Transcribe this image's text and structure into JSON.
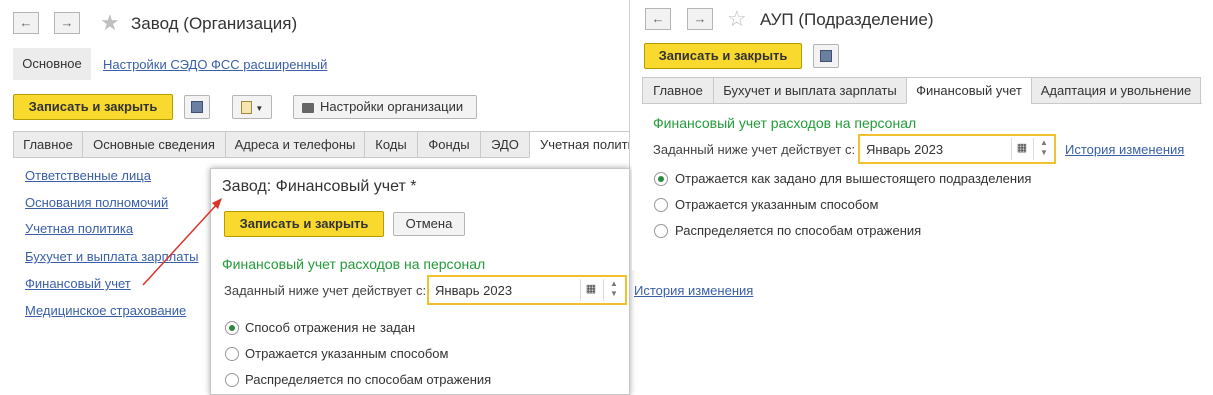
{
  "left_window": {
    "title": "Завод (Организация)",
    "nav_back": "🡐",
    "nav_forward": "🡒",
    "section_main": "Основное",
    "section_link": "Настройки СЭДО ФСС расширенный",
    "save_close": "Записать и закрыть",
    "org_settings": "Настройки организации",
    "tabs": [
      "Главное",
      "Основные сведения",
      "Адреса и телефоны",
      "Коды",
      "Фонды",
      "ЭДО",
      "Учетная полити"
    ],
    "sidebar": [
      "Ответственные лица",
      "Основания полномочий",
      "Учетная политика",
      "Бухучет и выплата зарплаты",
      "Финансовый учет",
      "Медицинское страхование"
    ]
  },
  "dialog": {
    "title": "Завод: Финансовый учет *",
    "save_close": "Записать и закрыть",
    "cancel": "Отмена",
    "heading": "Финансовый учет расходов на персонал",
    "date_label": "Заданный ниже учет действует с:",
    "date_value": "Январь 2023",
    "history_link": "История изменения",
    "options": [
      "Способ отражения не задан",
      "Отражается указанным способом",
      "Распределяется по способам отражения"
    ],
    "selected_option": 0
  },
  "right_window": {
    "title": "АУП (Подразделение)",
    "save_close": "Записать и закрыть",
    "tabs": [
      "Главное",
      "Бухучет и выплата зарплаты",
      "Финансовый учет",
      "Адаптация и увольнение"
    ],
    "heading": "Финансовый учет расходов на персонал",
    "date_label": "Заданный ниже учет действует с:",
    "date_value": "Январь 2023",
    "history_link": "История изменения",
    "options": [
      "Отражается как задано для вышестоящего подразделения",
      "Отражается указанным способом",
      "Распределяется по способам отражения"
    ],
    "selected_option": 0
  },
  "colors": {
    "accent_yellow": "#f9d92d",
    "link_blue": "#3a5fa8",
    "heading_green": "#239c3a",
    "arrow_red": "#d9352b"
  }
}
